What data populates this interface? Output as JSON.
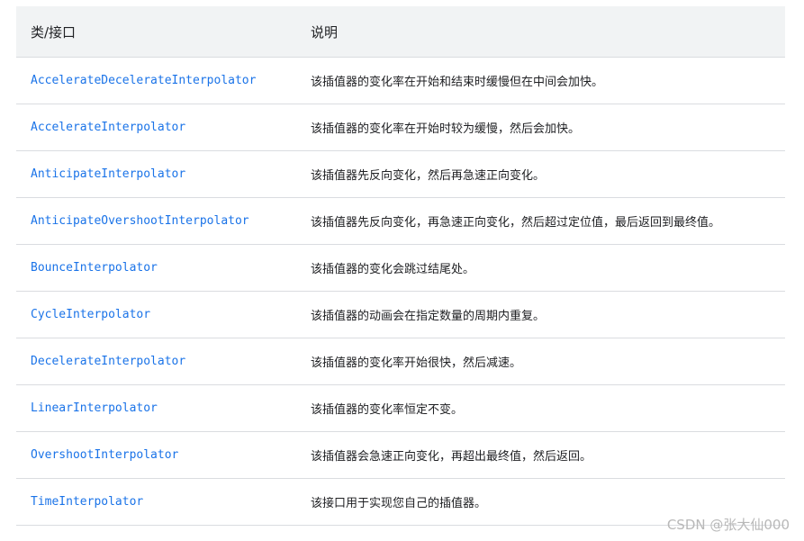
{
  "table": {
    "headers": [
      "类/接口",
      "说明"
    ],
    "rows": [
      {
        "cls": "AccelerateDecelerateInterpolator",
        "desc": "该插值器的变化率在开始和结束时缓慢但在中间会加快。"
      },
      {
        "cls": "AccelerateInterpolator",
        "desc": "该插值器的变化率在开始时较为缓慢，然后会加快。"
      },
      {
        "cls": "AnticipateInterpolator",
        "desc": "该插值器先反向变化，然后再急速正向变化。"
      },
      {
        "cls": "AnticipateOvershootInterpolator",
        "desc": "该插值器先反向变化，再急速正向变化，然后超过定位值，最后返回到最终值。"
      },
      {
        "cls": "BounceInterpolator",
        "desc": "该插值器的变化会跳过结尾处。"
      },
      {
        "cls": "CycleInterpolator",
        "desc": "该插值器的动画会在指定数量的周期内重复。"
      },
      {
        "cls": "DecelerateInterpolator",
        "desc": "该插值器的变化率开始很快，然后减速。"
      },
      {
        "cls": "LinearInterpolator",
        "desc": "该插值器的变化率恒定不变。"
      },
      {
        "cls": "OvershootInterpolator",
        "desc": "该插值器会急速正向变化，再超出最终值，然后返回。"
      },
      {
        "cls": "TimeInterpolator",
        "desc": "该接口用于实现您自己的插值器。"
      }
    ]
  },
  "watermark": "CSDN @张大仙000",
  "colors": {
    "header_bg": "#f1f3f4",
    "link": "#1a73e8",
    "border": "#dadce0"
  }
}
